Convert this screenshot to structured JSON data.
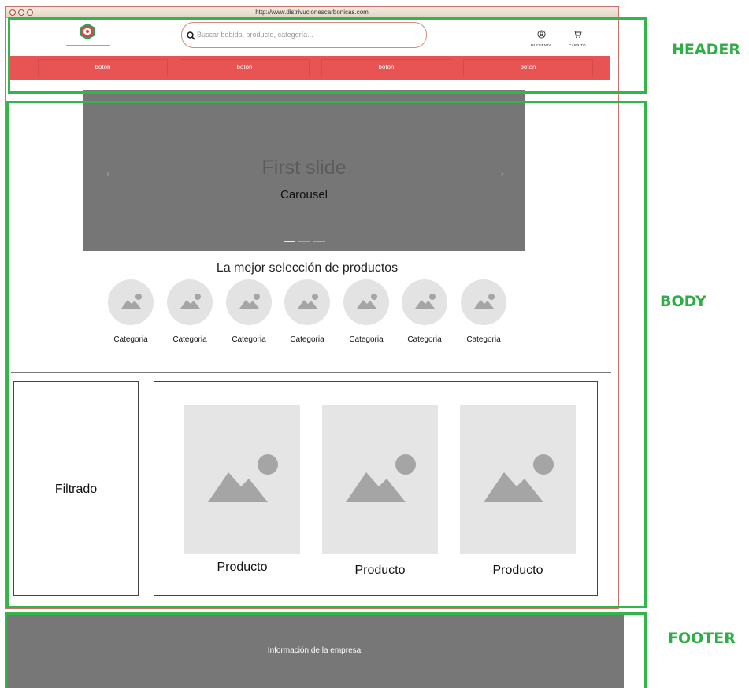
{
  "browser": {
    "url": "http://www.distrivucionescarbonicas.com"
  },
  "header": {
    "search_placeholder": "Buscar bebida, producto, categoría...",
    "account_label": "MI CUENTA",
    "cart_label": "CARRITO",
    "nav_buttons": [
      "boton",
      "boton",
      "boton",
      "boton"
    ]
  },
  "colors": {
    "accent": "#e85454",
    "annotation": "#33b54a",
    "carousel_bg": "#767676",
    "footer_bg": "#777777"
  },
  "carousel": {
    "slide_title": "First slide",
    "caption": "Carousel",
    "indicator_count": 3,
    "active_index": 0
  },
  "categories": {
    "title": "La mejor selección de productos",
    "items": [
      "Categoria",
      "Categoria",
      "Categoria",
      "Categoria",
      "Categoria",
      "Categoria",
      "Categoria"
    ]
  },
  "filter": {
    "label": "Filtrado"
  },
  "products": [
    "Producto",
    "Producto",
    "Producto"
  ],
  "footer": {
    "text": "Información de la empresa"
  },
  "annotations": {
    "header": "HEADER",
    "body": "BODY",
    "footer": "FOOTER"
  }
}
